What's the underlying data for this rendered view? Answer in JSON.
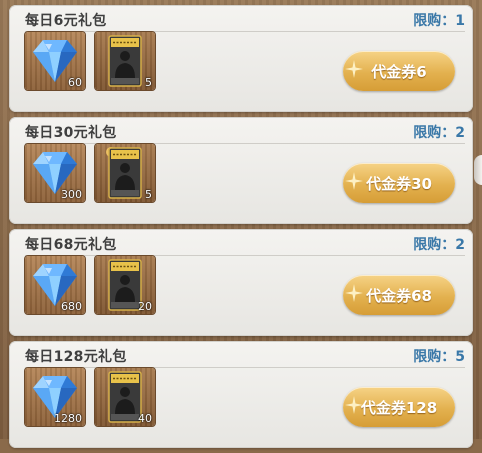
{
  "packs": [
    {
      "title": "每日6元礼包",
      "limit": "限购：1",
      "button": "代金券6",
      "items": [
        {
          "icon": "diamond-icon",
          "count": "60"
        },
        {
          "icon": "player-card-icon",
          "count": "5"
        }
      ]
    },
    {
      "title": "每日30元礼包",
      "limit": "限购：2",
      "button": "代金券30",
      "items": [
        {
          "icon": "diamond-icon",
          "count": "300"
        },
        {
          "icon": "player-card-icon",
          "count": "5"
        }
      ]
    },
    {
      "title": "每日68元礼包",
      "limit": "限购：2",
      "button": "代金券68",
      "items": [
        {
          "icon": "diamond-icon",
          "count": "680"
        },
        {
          "icon": "player-card-icon",
          "count": "20"
        }
      ]
    },
    {
      "title": "每日128元礼包",
      "limit": "限购：5",
      "button": "代金券128",
      "items": [
        {
          "icon": "diamond-icon",
          "count": "1280"
        },
        {
          "icon": "player-card-icon",
          "count": "40"
        }
      ]
    }
  ],
  "colors": {
    "limit_text": "#3a78a8",
    "button_gold": "#e3b14f",
    "panel_bg": "#f4f3f0"
  }
}
